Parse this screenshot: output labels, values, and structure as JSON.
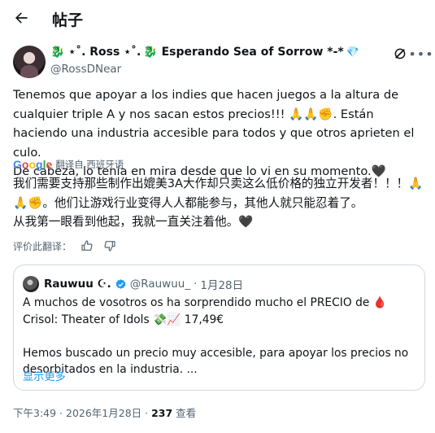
{
  "header": {
    "title": "帖子"
  },
  "author": {
    "display_name_prefix": "🐉 ⋆˚. Ross ⋆˚.",
    "display_name_suffix": "🐉 Esperando Sea of Sorrow *-*",
    "handle": "@RossDNear"
  },
  "tweet": {
    "text_es_1": "Tenemos que apoyar a los indies que hacen juegos a la altura de cualquier triple A y nos sacan estos precios!!! 🙏🙏✊. Están haciendo una industria accesible para todos y que otros aprieten el culo.",
    "text_es_2": "De cabeza, lo tenía en mira desde que lo vi en su momento.🖤",
    "translated_by": "翻译自 西班牙语",
    "text_zh_1": "我们需要支持那些制作出媲美3A大作却只卖这么低价格的独立开发者！！！🙏🙏✊。他们让游戏行业变得人人都能参与，其他人就只能忍着了。",
    "text_zh_2": "从我第一眼看到他起，我就一直关注着他。🖤",
    "rate_label": "评价此翻译："
  },
  "quote": {
    "name": "Rauwuu ☪︎.",
    "handle": "@Rauwuu_",
    "date": "1月28日",
    "text_1": "A muchos de vosotros os ha sorprendido mucho el PRECIO de 🩸 Crisol: Theater of Idols 💸📈 17,49€",
    "text_2": "Hemos buscado un precio muy accesible, para apoyar los precios no desorbitados en la industria. ...",
    "show_more": "显示更多"
  },
  "meta": {
    "time": "下午3:49 · 2026年1月28日 · ",
    "views_count": "237",
    "views_label": " 查看"
  },
  "colors": {
    "accent": "#1d9bf0",
    "muted": "#536471",
    "border": "#cfd9de"
  }
}
